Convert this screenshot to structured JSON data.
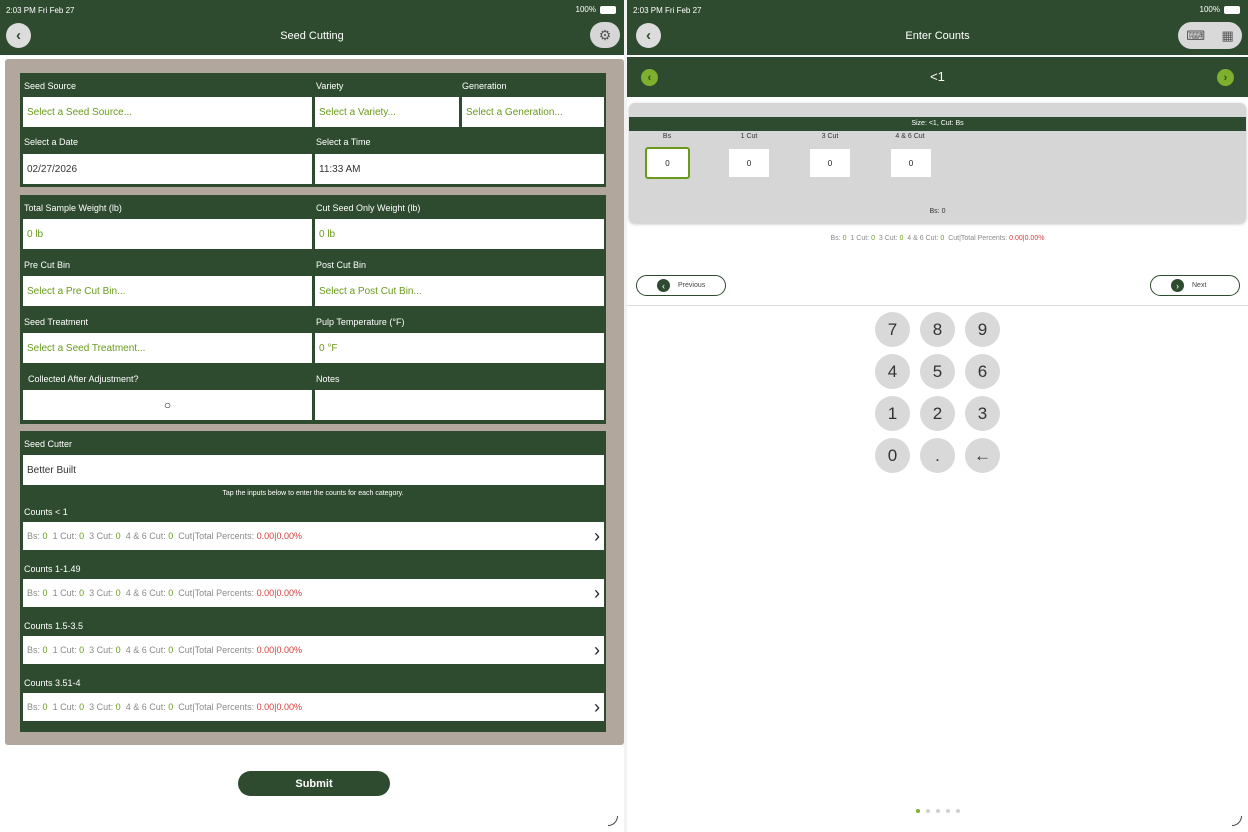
{
  "left": {
    "status": "2:03 PM  Fri Feb 27",
    "battery": "100%",
    "title": "Seed Cutting",
    "back_glyph": "‹",
    "gear_glyph": "⚙",
    "card1": {
      "seed_source_label": "Seed Source",
      "seed_source_placeholder": "Select a Seed Source...",
      "variety_label": "Variety",
      "variety_placeholder": "Select a Variety...",
      "generation_label": "Generation",
      "generation_placeholder": "Select a Generation...",
      "date_label": "Select a Date",
      "date_value": "02/27/2026",
      "time_label": "Select a Time",
      "time_value": "11:33 AM"
    },
    "card2": {
      "total_weight_label": "Total Sample Weight (lb)",
      "total_weight_value": "0 lb",
      "cut_weight_label": "Cut Seed Only Weight (lb)",
      "cut_weight_value": "0 lb",
      "pre_bin_label": "Pre Cut Bin",
      "pre_bin_placeholder": "Select a Pre Cut Bin...",
      "post_bin_label": "Post Cut Bin",
      "post_bin_placeholder": "Select a Post Cut Bin...",
      "treatment_label": "Seed Treatment",
      "treatment_placeholder": "Select a Seed Treatment...",
      "pulp_label": "Pulp Temperature (°F)",
      "pulp_value": "0 °F",
      "collected_label": "Collected After Adjustment?",
      "collected_glyph": "○",
      "notes_label": "Notes",
      "notes_value": ""
    },
    "card3": {
      "cutter_label": "Seed Cutter",
      "cutter_value": "Better Built",
      "hint": "Tap the inputs below to enter the counts for each category.",
      "counts": [
        {
          "label": "Counts < 1"
        },
        {
          "label": "Counts 1-1.49"
        },
        {
          "label": "Counts 1.5-3.5"
        },
        {
          "label": "Counts 3.51-4"
        }
      ]
    },
    "row_text": {
      "bs": "Bs:",
      "bs_val": "0",
      "c1": "1 Cut:",
      "c1_val": "0",
      "c3": "3 Cut:",
      "c3_val": "0",
      "c46": "4 & 6 Cut:",
      "c46_val": "0",
      "tail": "Cut|Total Percents:",
      "pct": "0.00|0.00%",
      "chevron": "›"
    },
    "submit": "Submit"
  },
  "right": {
    "status": "2:03 PM  Fri Feb 27",
    "battery": "100%",
    "title": "Enter Counts",
    "back_glyph": "‹",
    "keyboard_glyph": "⌨",
    "calculator_glyph": "▦",
    "subtitle": "<1",
    "size_bar": "Size: <1,  Cut: Bs",
    "columns": [
      {
        "label": "Bs",
        "value": "0"
      },
      {
        "label": "1 Cut",
        "value": "0"
      },
      {
        "label": "3 Cut",
        "value": "0"
      },
      {
        "label": "4 & 6 Cut",
        "value": "0"
      }
    ],
    "bs_footer": "Bs: 0",
    "prev_label": "Previous",
    "next_label": "Next",
    "keypad": [
      "7",
      "8",
      "9",
      "4",
      "5",
      "6",
      "1",
      "2",
      "3",
      "0",
      ".",
      "←"
    ]
  },
  "colors": {
    "dark_green": "#2e4b2f",
    "accent_green": "#6a9a1c",
    "red": "#d63c3c"
  }
}
